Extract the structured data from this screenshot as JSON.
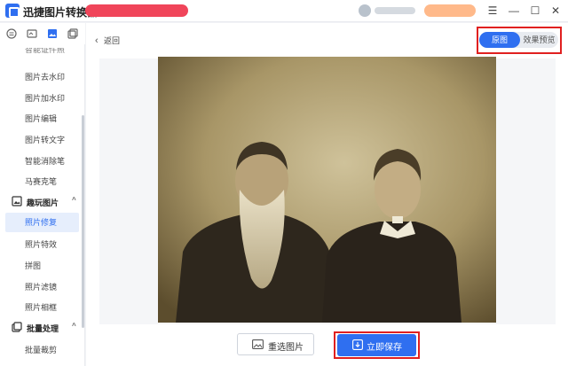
{
  "app": {
    "title": "迅捷图片转换器"
  },
  "window_controls": {
    "menu": "☰",
    "minimize": "—",
    "maximize": "☐",
    "close": "✕"
  },
  "sidebar": {
    "top_icons": [
      "list-icon",
      "image-convert-icon",
      "picture-icon",
      "layers-icon"
    ],
    "items_group1": [
      "智能证件照",
      "图片去水印",
      "图片加水印",
      "图片编辑",
      "图片转文字",
      "智能消除笔",
      "马赛克笔"
    ],
    "section_fun": {
      "label": "趣玩图片",
      "caret": "^"
    },
    "items_fun": [
      "照片修复",
      "照片特效",
      "拼图",
      "照片滤镜",
      "照片相框"
    ],
    "active_item": "照片修复",
    "section_batch": {
      "label": "批量处理",
      "caret": "^"
    },
    "items_batch": [
      "批量裁剪"
    ]
  },
  "main": {
    "back_label": "返回",
    "back_chevron": "‹",
    "toggle": {
      "original": "原图",
      "preview": "效果预览",
      "selected": "原图"
    },
    "buttons": {
      "reselect": "重选图片",
      "save": "立即保存"
    }
  },
  "colors": {
    "accent": "#2f6ff0",
    "highlight": "#e02020",
    "promo": "#f0455a"
  }
}
